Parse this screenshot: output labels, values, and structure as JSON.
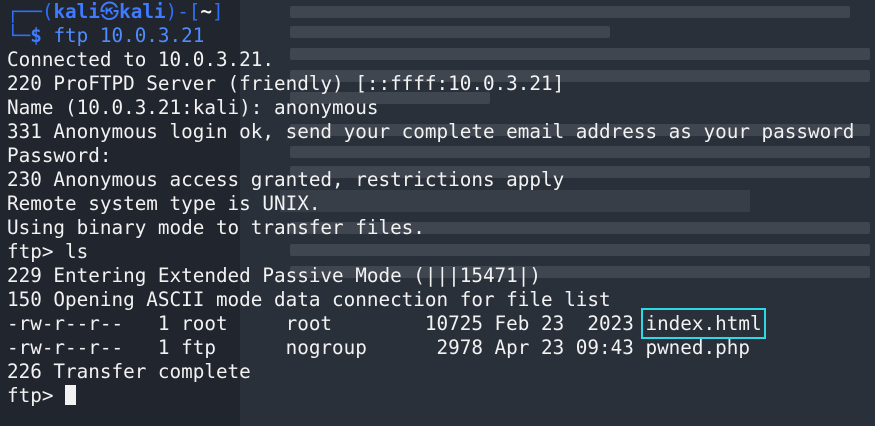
{
  "prompt": {
    "frame_top": "┌──(",
    "user": "kali",
    "at_symbol": "㉿",
    "host": "kali",
    "dir_open": ")-[",
    "dir": "~",
    "dir_close": "]",
    "frame_bottom": "└─",
    "dollar": "$",
    "command": "ftp 10.0.3.21"
  },
  "output_lines": [
    "Connected to 10.0.3.21.",
    "220 ProFTPD Server (friendly) [::ffff:10.0.3.21]",
    "Name (10.0.3.21:kali): anonymous",
    "331 Anonymous login ok, send your complete email address as your password",
    "Password:",
    "230 Anonymous access granted, restrictions apply",
    "Remote system type is UNIX.",
    "Using binary mode to transfer files.",
    "ftp> ls",
    "229 Entering Extended Passive Mode (|||15471|)",
    "150 Opening ASCII mode data connection for file list"
  ],
  "listing": [
    {
      "prefix": "-rw-r--r--   1 root     root        10725 Feb 23  2023 ",
      "filename": "index.html",
      "highlighted": true
    },
    {
      "prefix": "-rw-r--r--   1 ftp      nogroup      2978 Apr 23 09:43 ",
      "filename": "pwned.php",
      "highlighted": false
    }
  ],
  "after_listing": "226 Transfer complete",
  "final_prompt": "ftp> ",
  "colors": {
    "terminal_bg": "#20252e",
    "text": "#f2f2f2",
    "prompt_blue": "#3f7bff",
    "highlight_outline": "#2ed8e6"
  }
}
